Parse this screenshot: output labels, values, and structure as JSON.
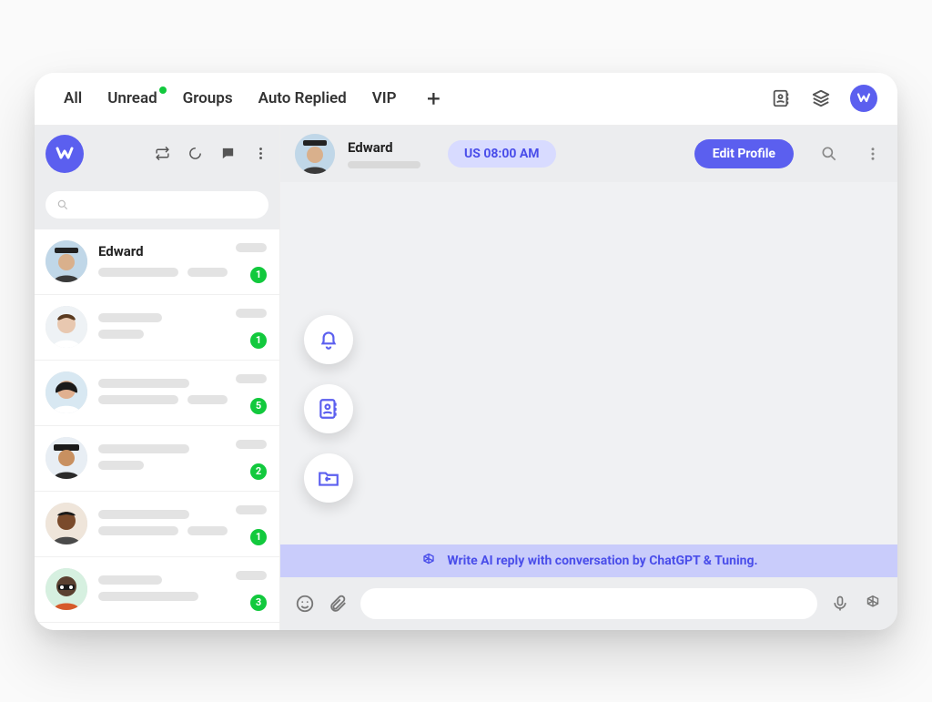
{
  "topnav": {
    "tabs": [
      "All",
      "Unread",
      "Groups",
      "Auto Replied",
      "VIP"
    ],
    "unread_has_dot": true
  },
  "sidebar": {
    "conversations": [
      {
        "name": "Edward",
        "badge": 1,
        "avatar_color": "#d9b08c",
        "hat": true
      },
      {
        "name": "",
        "badge": 1,
        "avatar_color": "#e8c8b0",
        "hat": false
      },
      {
        "name": "",
        "badge": 5,
        "avatar_color": "#2a2a2a",
        "hat": false
      },
      {
        "name": "",
        "badge": 2,
        "avatar_color": "#c89060",
        "hat": true
      },
      {
        "name": "",
        "badge": 1,
        "avatar_color": "#7a4a2b",
        "hat": false
      },
      {
        "name": "",
        "badge": 3,
        "avatar_color": "#5a4030",
        "hat": false
      }
    ]
  },
  "chat": {
    "header": {
      "name": "Edward",
      "time_label": "US 08:00 AM",
      "edit_label": "Edit Profile"
    },
    "ai_banner": "Write AI reply with conversation by ChatGPT & Tuning."
  }
}
